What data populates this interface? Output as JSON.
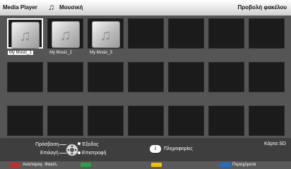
{
  "header": {
    "title": "Media Player",
    "icon": "music-note-icon",
    "subtitle": "Μουσική",
    "view_mode": "Προβολή φακέλου"
  },
  "grid": {
    "rows": 3,
    "cols": 7,
    "items": [
      {
        "label": "My Music_1",
        "selected": true
      },
      {
        "label": "My Music_2",
        "selected": false
      },
      {
        "label": "My Music_3",
        "selected": false
      }
    ]
  },
  "footer": {
    "access_label": "Πρόσβαση",
    "select_label": "Επιλογή",
    "exit_label": "Έξοδος",
    "back_label": "Επιστροφή",
    "info_button": "i",
    "info_label": "Πληροφορίες",
    "storage_label": "Κάρτα SD"
  },
  "colorbar": {
    "red_label": "Αναπαραγ. Φακέλ.",
    "green_label": "",
    "yellow_label": "",
    "blue_label": "Περιεχόμενα",
    "colors": {
      "red": "#c92a2a",
      "green": "#2f9e44",
      "yellow": "#f2c200",
      "blue": "#1c6fd1"
    }
  }
}
